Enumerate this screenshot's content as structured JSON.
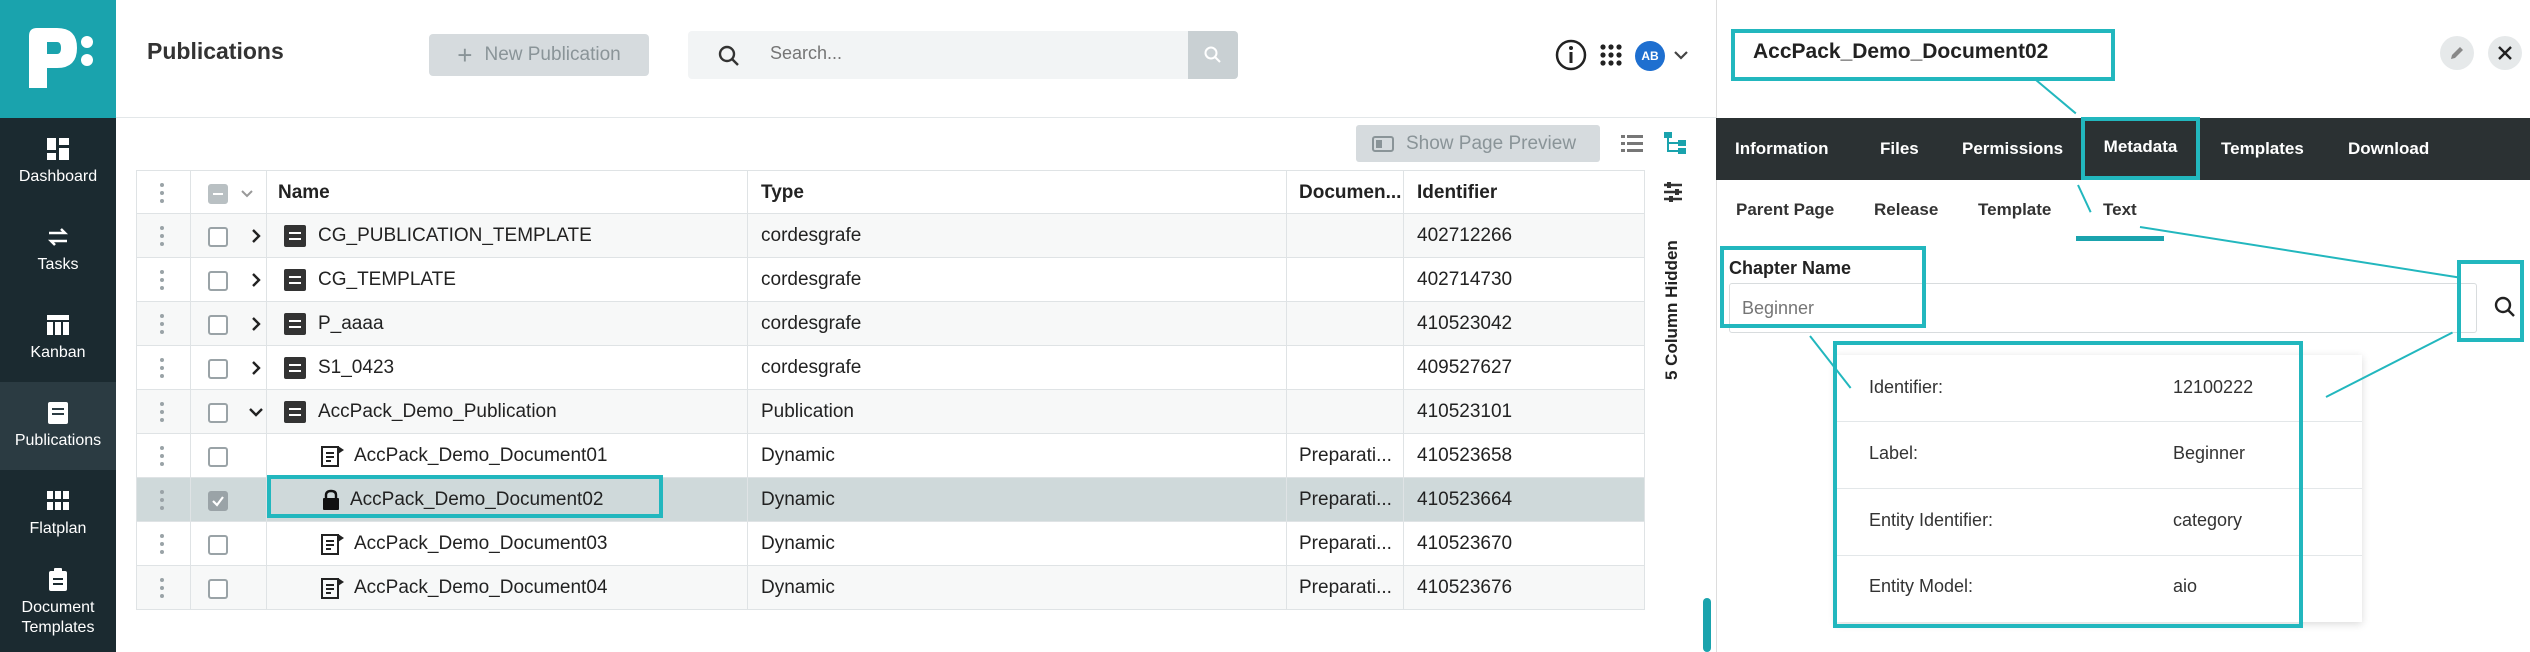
{
  "sidebar": {
    "items": [
      {
        "label": "Dashboard",
        "icon": "dashboard-icon"
      },
      {
        "label": "Tasks",
        "icon": "tasks-icon"
      },
      {
        "label": "Kanban",
        "icon": "kanban-icon"
      },
      {
        "label": "Publications",
        "icon": "publications-icon",
        "active": true
      },
      {
        "label": "Flatplan",
        "icon": "flatplan-icon"
      },
      {
        "label": "Document Templates",
        "icon": "document-templates-icon"
      }
    ]
  },
  "header": {
    "title": "Publications",
    "new_label": "New Publication",
    "search_placeholder": "Search...",
    "avatar": "AB"
  },
  "toolbar": {
    "preview_label": "Show Page Preview",
    "hidden_columns": "5 Column Hidden"
  },
  "table": {
    "columns": [
      "Name",
      "Type",
      "Documen...",
      "Identifier"
    ],
    "rows": [
      {
        "name": "CG_PUBLICATION_TEMPLATE",
        "type": "cordesgrafe",
        "doc": "",
        "id": "402712266"
      },
      {
        "name": "CG_TEMPLATE",
        "type": "cordesgrafe",
        "doc": "",
        "id": "402714730"
      },
      {
        "name": "P_aaaa",
        "type": "cordesgrafe",
        "doc": "",
        "id": "410523042"
      },
      {
        "name": "S1_0423",
        "type": "cordesgrafe",
        "doc": "",
        "id": "409527627"
      },
      {
        "name": "AccPack_Demo_Publication",
        "type": "Publication",
        "doc": "",
        "id": "410523101"
      },
      {
        "name": "AccPack_Demo_Document01",
        "type": "Dynamic",
        "doc": "Preparati...",
        "id": "410523658"
      },
      {
        "name": "AccPack_Demo_Document02",
        "type": "Dynamic",
        "doc": "Preparati...",
        "id": "410523664"
      },
      {
        "name": "AccPack_Demo_Document03",
        "type": "Dynamic",
        "doc": "Preparati...",
        "id": "410523670"
      },
      {
        "name": "AccPack_Demo_Document04",
        "type": "Dynamic",
        "doc": "Preparati...",
        "id": "410523676"
      }
    ]
  },
  "panel": {
    "title": "AccPack_Demo_Document02",
    "tabs": [
      "Information",
      "Files",
      "Permissions",
      "Metadata",
      "Templates",
      "Download"
    ],
    "subtabs": [
      "Parent Page",
      "Release",
      "Template",
      "Text"
    ],
    "chapter_label": "Chapter Name",
    "chapter_placeholder": "Beginner",
    "details": [
      {
        "k": "Identifier:",
        "v": "12100222"
      },
      {
        "k": "Label:",
        "v": "Beginner"
      },
      {
        "k": "Entity Identifier:",
        "v": "category"
      },
      {
        "k": "Entity Model:",
        "v": "aio"
      }
    ]
  },
  "colors": {
    "accent": "#22b7be",
    "sidebar": "#1b2a30",
    "logo": "#1aa3ad"
  }
}
